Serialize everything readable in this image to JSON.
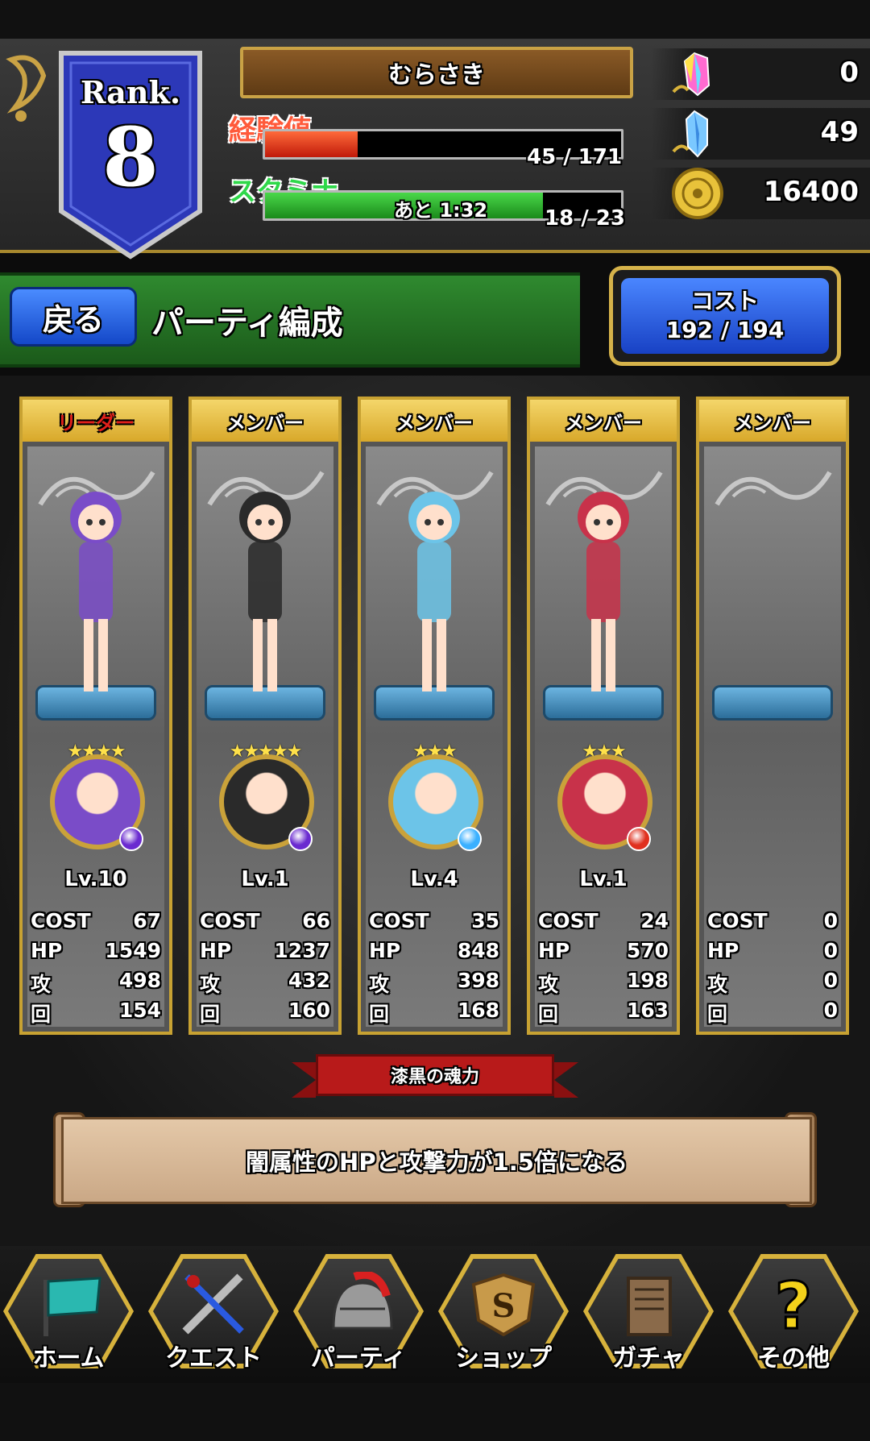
{
  "header": {
    "rank_label": "Rank.",
    "rank_value": "8",
    "player_name": "むらさき",
    "exp_label": "経験値",
    "exp_text": "45 / 171",
    "exp_progress": 0.26,
    "stamina_label": "スタミナ",
    "stamina_timer": "あと 1:32",
    "stamina_text": "18 / 23",
    "stamina_progress": 0.78,
    "rainbow_gem_count": "0",
    "blue_gem_count": "49",
    "gold_count": "16400"
  },
  "party": {
    "back_label": "戻る",
    "title": "パーティ編成",
    "cost_label": "コスト",
    "cost_value": "192 / 194"
  },
  "stat_labels": {
    "cost": "COST",
    "hp": "HP",
    "atk": "攻",
    "rec": "回"
  },
  "members": [
    {
      "role": "リーダー",
      "level": "Lv.10",
      "stars": "★★★★",
      "cost": "67",
      "hp": "1549",
      "atk": "498",
      "rec": "154",
      "element": "dark",
      "hair": "#7a4cc8"
    },
    {
      "role": "メンバー",
      "level": "Lv.1",
      "stars": "★★★★★",
      "cost": "66",
      "hp": "1237",
      "atk": "432",
      "rec": "160",
      "element": "dark",
      "hair": "#2a2a2a"
    },
    {
      "role": "メンバー",
      "level": "Lv.4",
      "stars": "★★★",
      "cost": "35",
      "hp": "848",
      "atk": "398",
      "rec": "168",
      "element": "water",
      "hair": "#6cc4e8"
    },
    {
      "role": "メンバー",
      "level": "Lv.1",
      "stars": "★★★",
      "cost": "24",
      "hp": "570",
      "atk": "198",
      "rec": "163",
      "element": "fire",
      "hair": "#c8324a"
    },
    {
      "role": "メンバー",
      "level": "",
      "stars": "",
      "cost": "0",
      "hp": "0",
      "atk": "0",
      "rec": "0",
      "element": "",
      "hair": ""
    }
  ],
  "skill": {
    "name": "漆黒の魂力",
    "description": "闇属性のHPと攻撃力が1.5倍になる"
  },
  "nav": [
    {
      "label": "ホーム",
      "icon": "flag-icon"
    },
    {
      "label": "クエスト",
      "icon": "swords-icon"
    },
    {
      "label": "パーティ",
      "icon": "helmet-icon"
    },
    {
      "label": "ショップ",
      "icon": "shield-s-icon"
    },
    {
      "label": "ガチャ",
      "icon": "scroll-board-icon"
    },
    {
      "label": "その他",
      "icon": "question-icon"
    }
  ],
  "colors": {
    "accent_gold": "#c8a232",
    "exp_red": "#e0301e",
    "stamina_green": "#2fa82f",
    "button_blue": "#1e5ee0",
    "leader_red": "#e0201a"
  }
}
